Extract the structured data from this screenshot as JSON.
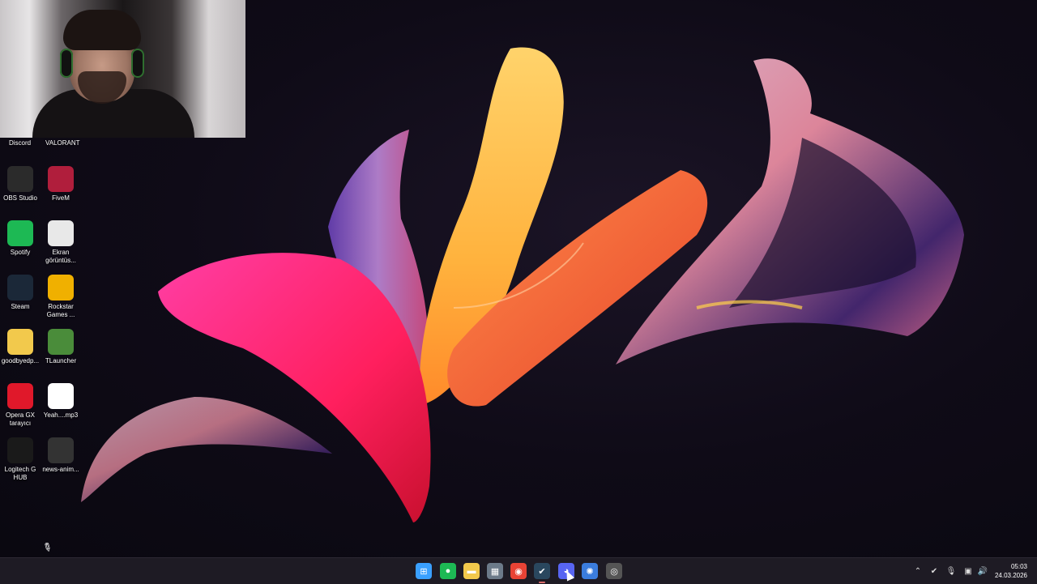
{
  "desktop": {
    "top_labels": [
      "Discord",
      "VALORANT"
    ],
    "icons": [
      {
        "label": "OBS Studio",
        "icon": "obs-icon",
        "color": "#2b2b2b"
      },
      {
        "label": "FiveM",
        "icon": "fivem-icon",
        "color": "#b01e3c"
      },
      {
        "label": "Spotify",
        "icon": "spotify-icon",
        "color": "#1db954"
      },
      {
        "label": "Ekran görüntüs...",
        "icon": "screenshot-file-icon",
        "color": "#e8e8e8"
      },
      {
        "label": "Steam",
        "icon": "steam-icon",
        "color": "#1b2838"
      },
      {
        "label": "Rockstar Games ...",
        "icon": "rockstar-icon",
        "color": "#f0b000"
      },
      {
        "label": "goodbyedp...",
        "icon": "folder-icon",
        "color": "#f2c94c"
      },
      {
        "label": "TLauncher",
        "icon": "tlauncher-icon",
        "color": "#4a8c3a"
      },
      {
        "label": "Opera GX tarayıcı",
        "icon": "opera-gx-icon",
        "color": "#e0182a"
      },
      {
        "label": "Yeah....mp3",
        "icon": "audio-file-icon",
        "color": "#ffffff"
      },
      {
        "label": "Logitech G HUB",
        "icon": "logitech-icon",
        "color": "#1a1a1a"
      },
      {
        "label": "news-anim...",
        "icon": "file-icon",
        "color": "#333333"
      }
    ]
  },
  "taskbar": {
    "apps": [
      {
        "name": "start",
        "icon": "windows-start-icon",
        "glyph": "⊞",
        "color": "#3aa0ff"
      },
      {
        "name": "spotify",
        "icon": "spotify-icon",
        "glyph": "●",
        "color": "#1db954"
      },
      {
        "name": "file-explorer",
        "icon": "folder-icon",
        "glyph": "▬",
        "color": "#f2c94c"
      },
      {
        "name": "store",
        "icon": "store-icon",
        "glyph": "▦",
        "color": "#6c7a89"
      },
      {
        "name": "chrome",
        "icon": "chrome-icon",
        "glyph": "◉",
        "color": "#e84335"
      },
      {
        "name": "steam",
        "icon": "steam-icon",
        "glyph": "✔",
        "color": "#2a475e"
      },
      {
        "name": "discord",
        "icon": "discord-icon",
        "glyph": "◕",
        "color": "#5865f2"
      },
      {
        "name": "settings-app",
        "icon": "gear-blue-icon",
        "glyph": "✺",
        "color": "#3b7ddd"
      },
      {
        "name": "obs",
        "icon": "obs-icon",
        "glyph": "◎",
        "color": "#555555"
      }
    ],
    "clock": {
      "time": "05:03",
      "date": "24.03.2026"
    }
  }
}
